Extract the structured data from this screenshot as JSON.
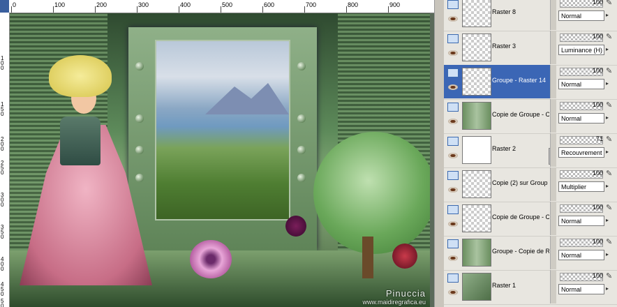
{
  "ruler": {
    "top_labels": [
      "0",
      "100",
      "200",
      "300",
      "400",
      "500",
      "600",
      "700",
      "800",
      "900"
    ],
    "left_labels": [
      "1\n0\n0",
      "1\n5\n0",
      "2\n0\n0",
      "2\n5\n0",
      "3\n0\n0",
      "3\n5\n0",
      "4\n0\n0",
      "4\n5\n0",
      "5\n0\n0"
    ]
  },
  "watermark": {
    "line1": "Pinuccia",
    "line2": "www.maidiregrafica.eu"
  },
  "layers": [
    {
      "name": "Raster 8",
      "opacity": "100",
      "blend": "Normal",
      "thumb": "checker",
      "selected": false
    },
    {
      "name": "Raster 3",
      "opacity": "100",
      "blend": "Luminance (H)",
      "thumb": "checker",
      "selected": false
    },
    {
      "name": "Groupe - Raster 14",
      "opacity": "100",
      "blend": "Normal",
      "thumb": "checker",
      "selected": true
    },
    {
      "name": "Copie de Groupe - C",
      "opacity": "100",
      "blend": "Normal",
      "thumb": "groupimg",
      "selected": false
    },
    {
      "name": "Raster 2",
      "opacity": "71",
      "blend": "Recouvrement",
      "thumb": "white",
      "selected": false
    },
    {
      "name": "Copie (2) sur Group",
      "opacity": "100",
      "blend": "Multiplier",
      "thumb": "checker",
      "selected": false
    },
    {
      "name": "Copie de Groupe - C",
      "opacity": "100",
      "blend": "Normal",
      "thumb": "checker",
      "selected": false
    },
    {
      "name": "Groupe - Copie de R",
      "opacity": "100",
      "blend": "Normal",
      "thumb": "groupimg",
      "selected": false
    },
    {
      "name": "Raster 1",
      "opacity": "100",
      "blend": "Normal",
      "thumb": "green",
      "selected": false
    }
  ],
  "icons": {
    "visibility": "eye-icon",
    "link": "layer-link-icon",
    "edit": "pencil-icon",
    "dropdown": "chevron-right-icon"
  },
  "colors": {
    "selection": "#3b66b5",
    "panel_bg": "#e8e6e0"
  }
}
